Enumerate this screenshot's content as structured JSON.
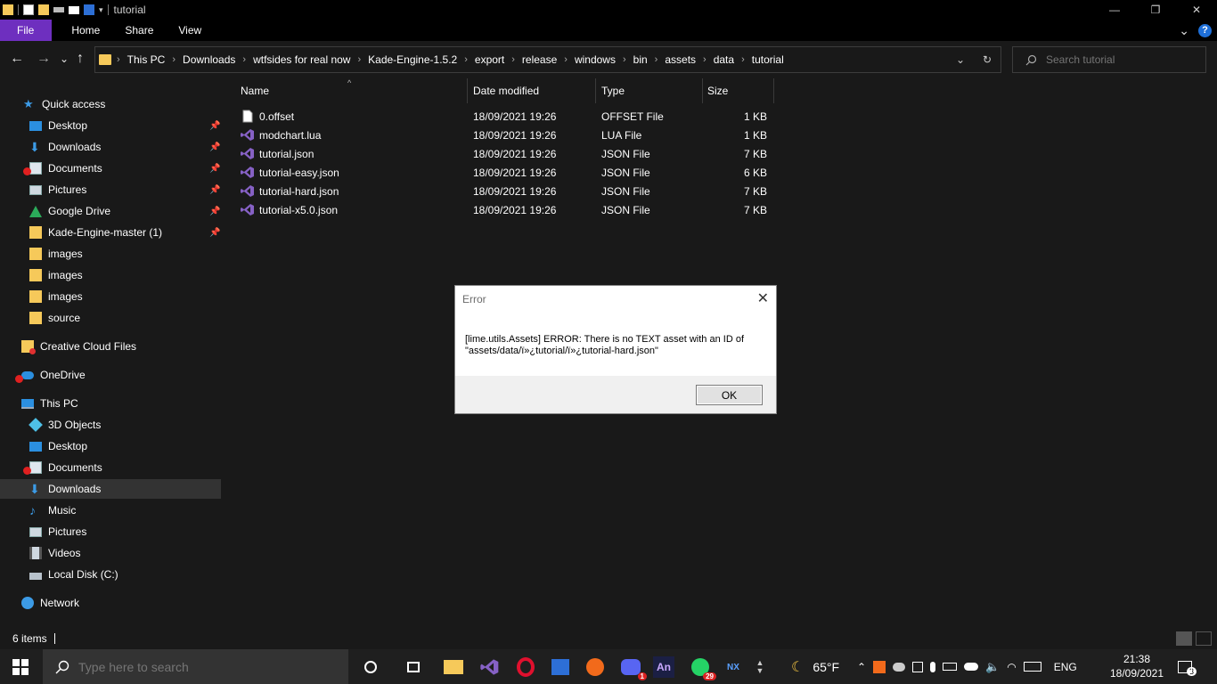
{
  "window": {
    "title": "tutorial",
    "controls": {
      "minimize": "—",
      "maximize": "❐",
      "close": "✕"
    }
  },
  "ribbon": {
    "tabs": [
      "File",
      "Home",
      "Share",
      "View"
    ],
    "expand": "⌄",
    "help": "?"
  },
  "nav": {
    "back": "←",
    "forward": "→",
    "recent": "⌄",
    "up": "↑"
  },
  "address": {
    "crumbs": [
      "This PC",
      "Downloads",
      "wtfsides for real now",
      "Kade-Engine-1.5.2",
      "export",
      "release",
      "windows",
      "bin",
      "assets",
      "data",
      "tutorial"
    ],
    "separator": "›",
    "dropdown": "⌄",
    "refresh": "↻"
  },
  "search": {
    "placeholder": "Search tutorial"
  },
  "sidebar": {
    "quick_access": "Quick access",
    "quick_items": [
      "Desktop",
      "Downloads",
      "Documents",
      "Pictures",
      "Google Drive",
      "Kade-Engine-master (1)",
      "images",
      "images",
      "images",
      "source"
    ],
    "creative_cloud": "Creative Cloud Files",
    "onedrive": "OneDrive",
    "this_pc": "This PC",
    "pc_items": [
      "3D Objects",
      "Desktop",
      "Documents",
      "Downloads",
      "Music",
      "Pictures",
      "Videos",
      "Local Disk (C:)"
    ],
    "network": "Network",
    "pin": "📌"
  },
  "columns": {
    "name": "Name",
    "date": "Date modified",
    "type": "Type",
    "size": "Size",
    "sort_indicator": "^"
  },
  "files": [
    {
      "name": "0.offset",
      "date": "18/09/2021 19:26",
      "type": "OFFSET File",
      "size": "1 KB"
    },
    {
      "name": "modchart.lua",
      "date": "18/09/2021 19:26",
      "type": "LUA File",
      "size": "1 KB"
    },
    {
      "name": "tutorial.json",
      "date": "18/09/2021 19:26",
      "type": "JSON File",
      "size": "7 KB"
    },
    {
      "name": "tutorial-easy.json",
      "date": "18/09/2021 19:26",
      "type": "JSON File",
      "size": "6 KB"
    },
    {
      "name": "tutorial-hard.json",
      "date": "18/09/2021 19:26",
      "type": "JSON File",
      "size": "7 KB"
    },
    {
      "name": "tutorial-x5.0.json",
      "date": "18/09/2021 19:26",
      "type": "JSON File",
      "size": "7 KB"
    }
  ],
  "status": {
    "items_count": "6 items"
  },
  "dialog": {
    "title": "Error",
    "close": "✕",
    "message_line1": "[lime.utils.Assets] ERROR: There is no TEXT asset with an ID of",
    "message_line2": "\"assets/data/ï»¿tutorial/ï»¿tutorial-hard.json\"",
    "ok": "OK"
  },
  "taskbar": {
    "search_placeholder": "Type here to search",
    "apps": [
      {
        "name": "task-view",
        "label": ""
      },
      {
        "name": "widgets",
        "label": ""
      },
      {
        "name": "file-explorer",
        "label": ""
      },
      {
        "name": "visual-studio",
        "label": ""
      },
      {
        "name": "opera",
        "label": ""
      },
      {
        "name": "powershell",
        "label": ""
      },
      {
        "name": "brave",
        "label": ""
      },
      {
        "name": "discord",
        "label": "",
        "badge": "1"
      },
      {
        "name": "animate",
        "label": "An"
      },
      {
        "name": "whatsapp",
        "label": "",
        "badge": "29"
      },
      {
        "name": "nx",
        "label": "NX"
      }
    ],
    "weather": "65°F",
    "language": "ENG",
    "time": "21:38",
    "date": "18/09/2021",
    "notifications": "3"
  },
  "colors": {
    "file_tab": "#6e2fbf",
    "folder": "#f6c95a",
    "vs_purple": "#8661c5",
    "selected": "#333333"
  }
}
